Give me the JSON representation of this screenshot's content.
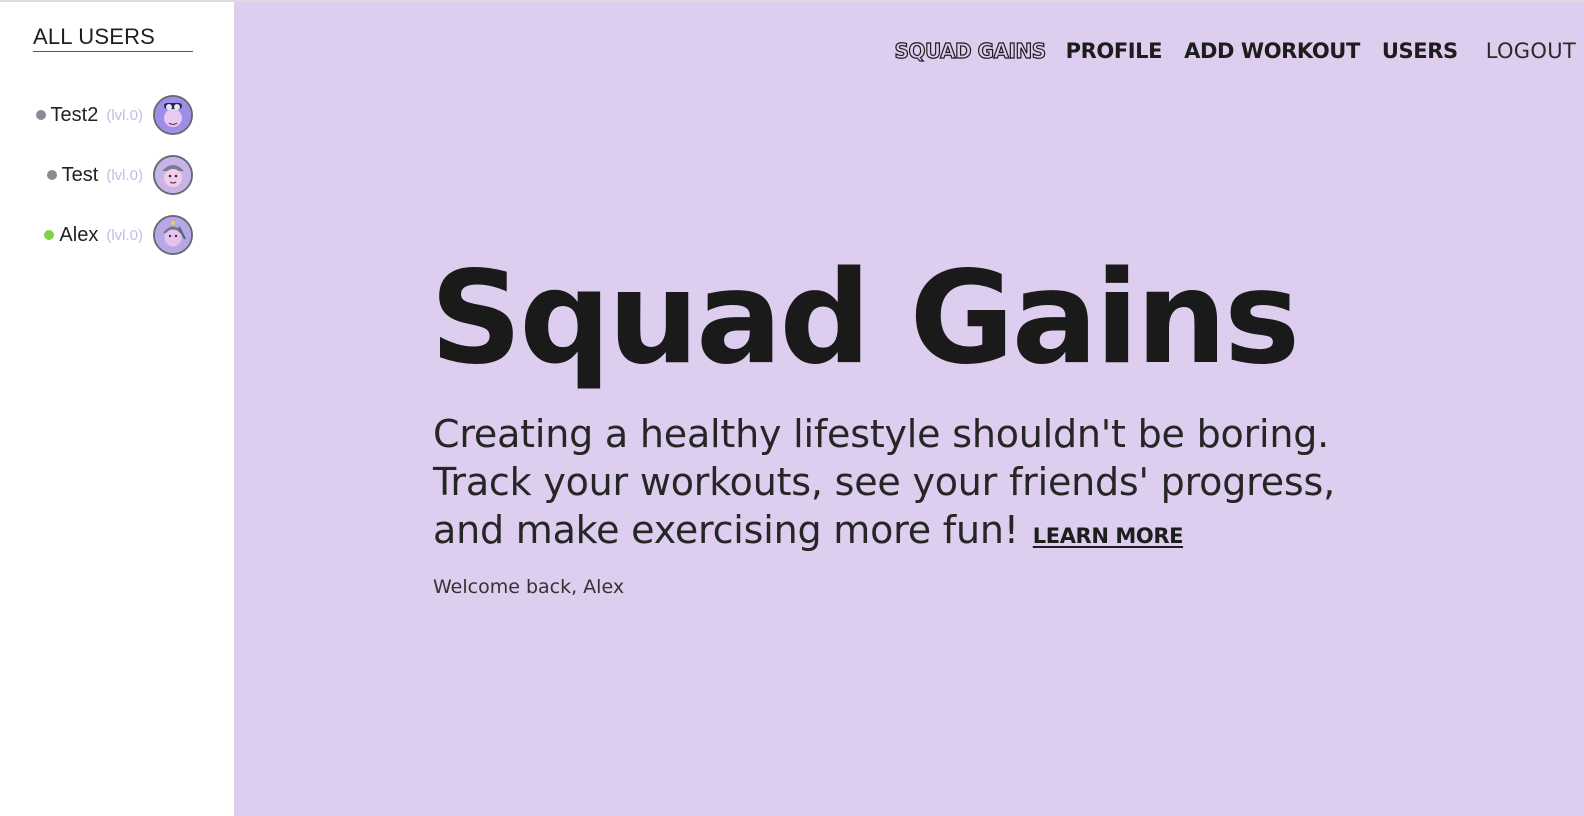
{
  "sidebar": {
    "title": "ALL USERS",
    "users": [
      {
        "name": "Test2",
        "level": "(lvl.0)",
        "status_color": "#8a8a94",
        "avatar": "avatar-icon"
      },
      {
        "name": "Test",
        "level": "(lvl.0)",
        "status_color": "#8a8a94",
        "avatar": "avatar-icon"
      },
      {
        "name": "Alex",
        "level": "(lvl.0)",
        "status_color": "#7bd44a",
        "avatar": "avatar-icon"
      }
    ]
  },
  "nav": {
    "brand": "SQUAD GAINS",
    "links": [
      "PROFILE",
      "ADD WORKOUT",
      "USERS"
    ],
    "logout": "LOGOUT"
  },
  "hero": {
    "title": "Squad Gains",
    "description": "Creating a healthy lifestyle shouldn't be boring. Track your workouts, see your friends' progress, and make exercising more fun!",
    "learn_more": "LEARN MORE",
    "welcome": "Welcome back, Alex"
  },
  "colors": {
    "main_background": "#ddcdee",
    "sidebar_background": "#ffffff",
    "text_dark": "#1a1a1a",
    "level_text": "#c9b8e6",
    "online": "#7bd44a",
    "offline": "#8a8a94"
  }
}
